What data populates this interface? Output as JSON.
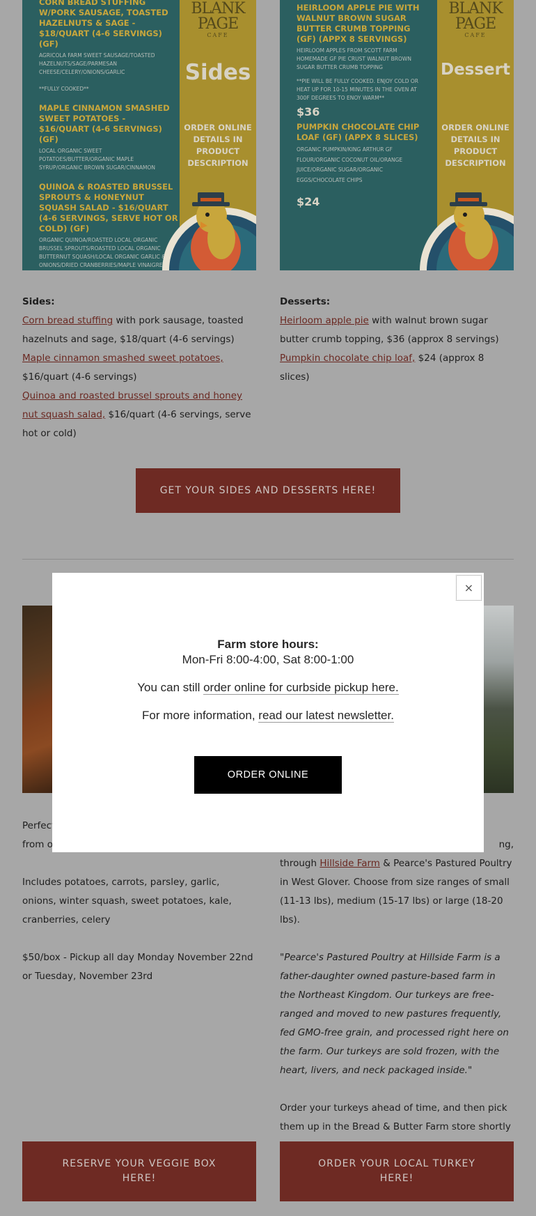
{
  "flyers": {
    "sides": {
      "logo_main": "BLANK PAGE",
      "logo_sub": "CAFE",
      "panel_title": "Sides",
      "panel_order": "ORDER ONLINE DETAILS IN PRODUCT DESCRIPTION",
      "items": [
        {
          "name": "CORN BREAD STUFFING W/PORK SAUSAGE, TOASTED HAZELNUTS & SAGE  - $18/QUART (4-6 SERVINGS) (GF)",
          "desc": "AGRICOLA FARM SWEET SAUSAGE/TOASTED HAZELNUTS/SAGE/PARMESAN CHEESE/CELERY/ONIONS/GARLIC\n\n**FULLY COOKED**"
        },
        {
          "name": "MAPLE CINNAMON SMASHED SWEET POTATOES - $16/QUART (4-6 SERVINGS) (GF)",
          "desc": "LOCAL ORGANIC SWEET POTATOES/BUTTER/ORGANIC MAPLE SYRUP/ORGANIC BROWN SUGAR/CINNAMON"
        },
        {
          "name": "QUINOA & ROASTED BRUSSEL SPROUTS & HONEYNUT SQUASH SALAD - $16/QUART (4-6 SERVINGS, SERVE HOT OR COLD) (GF)",
          "desc": "ORGANIC QUINOA/ROASTED LOCAL ORGANIC BRUSSEL SPROUTS/ROASTED LOCAL ORGANIC BUTTERNUT SQUASH/LOCAL ORGANIC GARLIC & ONIONS/DRIED CRANBERRIES/MAPLE VINAIGRETTE"
        }
      ]
    },
    "desserts": {
      "logo_main": "BLANK PAGE",
      "logo_sub": "CAFE",
      "panel_title": "Dessert",
      "panel_order": "ORDER ONLINE DETAILS IN PRODUCT DESCRIPTION",
      "item1_name": "HEIRLOOM APPLE PIE WITH WALNUT BROWN SUGAR BUTTER CRUMB TOPPING (GF) (APPX 8 SERVINGS)",
      "item1_desc": "HEIRLOOM APPLES FROM SCOTT FARM HOMEMADE GF PIE CRUST WALNUT BROWN SUGAR BUTTER CRUMB TOPPING",
      "item1_note": "**PIE WILL BE FULLY COOKED. ENJOY COLD OR HEAT UP FOR 10-15 MINUTES IN THE OVEN AT 300F DEGREES TO ENOY WARM**",
      "item1_price": "$36",
      "item2_name": "PUMPKIN CHOCOLATE CHIP LOAF (GF) (APPX 8 SLICES)",
      "item2_desc": "ORGANIC PUMPKIN/KING ARTHUR GF FLOUR/ORGANIC COCONUT OIL/ORANGE JUICE/ORGANIC SUGAR/ORGANIC EGGS/CHOCOLATE CHIPS",
      "item2_price": "$24"
    }
  },
  "sides_text": {
    "label": "Sides:",
    "corn_link": "Corn bread stuffing",
    "corn_rest": " with pork sausage, toasted hazelnuts and sage, $18/quart (4-6 servings)",
    "maple_link": "Maple cinnamon smashed sweet potatoes,",
    "maple_rest": " $16/quart (4-6 servings)",
    "quinoa_link": "Quinoa and roasted brussel sprouts and honey nut squash salad,",
    "quinoa_rest": " $16/quart (4-6 servings, serve hot or cold)"
  },
  "desserts_text": {
    "label": "Desserts:",
    "pie_link": "Heirloom apple pie",
    "pie_rest": " with walnut brown sugar butter crumb topping, $36 (approx 8 servings)",
    "loaf_link": "Pumpkin chocolate chip loaf,",
    "loaf_rest": " $24 (approx 8 slices)"
  },
  "buttons": {
    "sides_desserts": "GET YOUR SIDES AND DESSERTS HERE!",
    "veggie": "RESERVE YOUR VEGGIE BOX HERE!",
    "turkey": "ORDER YOUR LOCAL TURKEY HERE!"
  },
  "veggie_text": {
    "line1_partial": "Perfect",
    "line2_partial": "from o",
    "includes": "Includes potatoes, carrots, parsley, garlic, onions, winter squash, sweet potatoes, kale, cranberries, celery",
    "price": "$50/box - Pickup all day Monday November 22nd or Tuesday, November 23rd"
  },
  "turkey_text": {
    "line1_partial": "ng,",
    "through": "through ",
    "farm_link": "Hillside Farm",
    "farm_rest": " & Pearce's Pastured Poultry in West Glover. Choose from size ranges of small (11-13 lbs), medium (15-17 lbs) or large (18-20 lbs).",
    "quote": "\"Pearce's Pastured Poultry at Hillside Farm is a father-daughter owned pasture-based farm in the Northeast Kingdom. Our turkeys are free-ranged and moved to new pastures frequently, fed GMO-free grain, and processed right here on the farm. Our turkeys are sold frozen, with the heart, livers, and neck packaged inside.\"",
    "order": "Order your turkeys ahead of time, and then pick them up in the Bread & Butter Farm store shortly before Thanksgiving (pickup details to come)."
  },
  "modal": {
    "close": "×",
    "title": "Farm store hours:",
    "hours": "Mon-Fri 8:00-4:00, Sat 8:00-1:00",
    "order_prefix": "You can still ",
    "order_link": "order online for curbside pickup here.",
    "info_prefix": "For more information, ",
    "info_link": "read our latest newsletter.",
    "button": "ORDER ONLINE"
  }
}
